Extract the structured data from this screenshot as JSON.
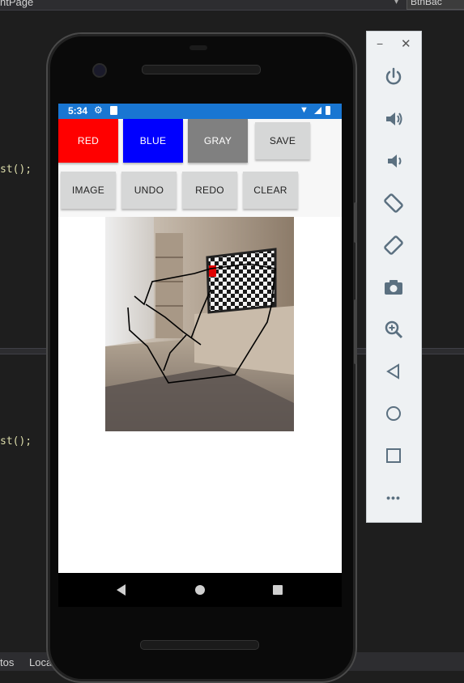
{
  "ide": {
    "top_left_text": "ntPage",
    "top_right_text": "BtnBac",
    "code_line_1": "st();",
    "code_line_2": "st();",
    "bottom_left": "tos",
    "bottom_left_2": "Loca"
  },
  "statusbar": {
    "time": "5:34"
  },
  "toolbar": {
    "row1": [
      "RED",
      "BLUE",
      "GRAY",
      "SAVE"
    ],
    "row2": [
      "IMAGE",
      "UNDO",
      "REDO",
      "CLEAR"
    ]
  },
  "colors": {
    "red": "#ff0000",
    "blue": "#0000ff",
    "gray": "#808080",
    "statusbar": "#1976d2"
  },
  "emulator_panel": {
    "icons": [
      "power-icon",
      "volume-up-icon",
      "volume-down-icon",
      "rotate-left-icon",
      "rotate-right-icon",
      "camera-icon",
      "zoom-icon",
      "back-icon",
      "home-icon",
      "overview-icon",
      "more-icon"
    ],
    "minimize": "−",
    "close": "✕",
    "more": "•••"
  }
}
